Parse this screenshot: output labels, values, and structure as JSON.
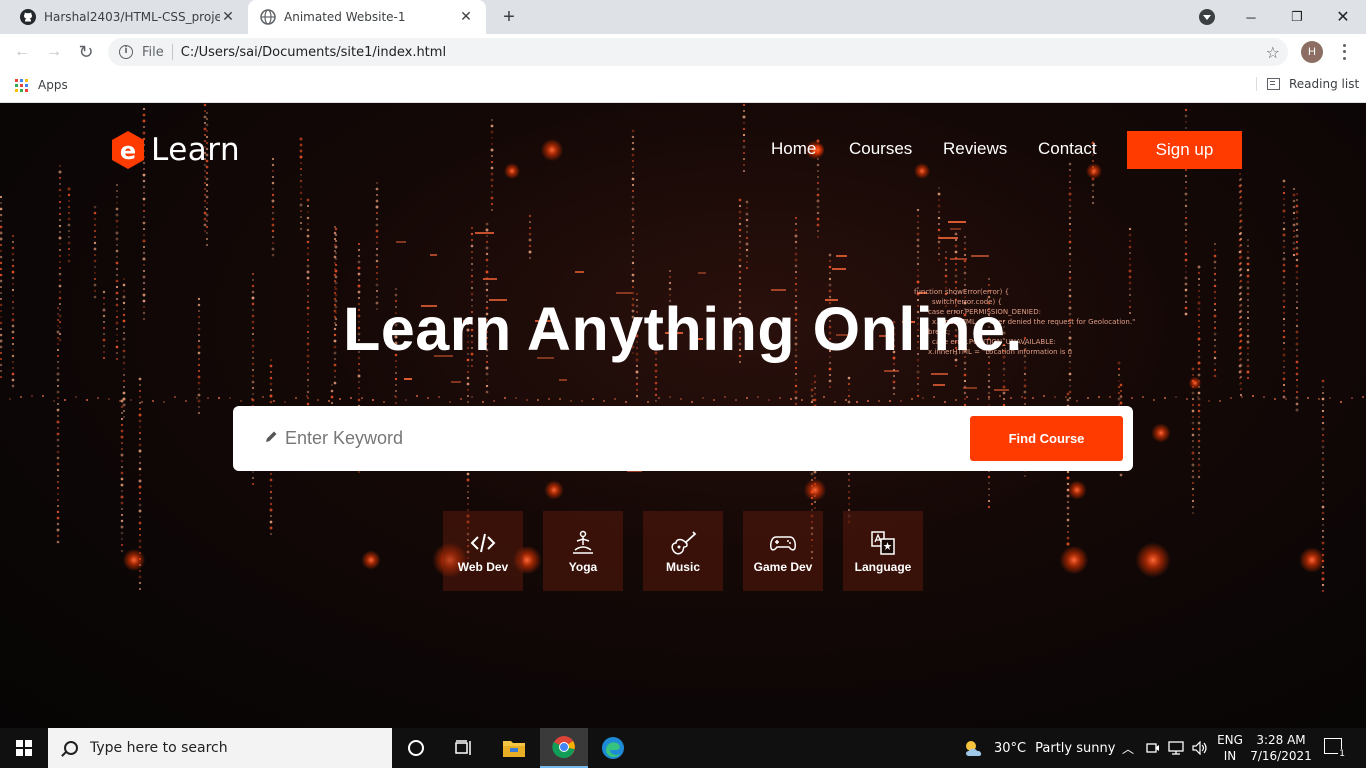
{
  "browser": {
    "tabs": [
      {
        "title": "Harshal2403/HTML-CSS_projects",
        "icon": "github-icon",
        "active": false
      },
      {
        "title": "Animated Website-1",
        "icon": "globe-icon",
        "active": true
      }
    ],
    "omnibox": {
      "scheme_label": "File",
      "url": "C:/Users/sai/Documents/site1/index.html"
    },
    "profile_initial": "H",
    "bookmarks": {
      "apps_label": "Apps",
      "reading_list_label": "Reading list"
    }
  },
  "site": {
    "logo_text": "Learn",
    "logo_letter": "e",
    "nav": [
      "Home",
      "Courses",
      "Reviews",
      "Contact"
    ],
    "signup_label": "Sign up",
    "hero_title": "Learn Anything Online.",
    "search": {
      "placeholder": "Enter Keyword",
      "button_label": "Find Course"
    },
    "categories": [
      {
        "label": "Web Dev",
        "icon": "code-icon"
      },
      {
        "label": "Yoga",
        "icon": "yoga-icon"
      },
      {
        "label": "Music",
        "icon": "guitar-icon"
      },
      {
        "label": "Game Dev",
        "icon": "gamepad-icon"
      },
      {
        "label": "Language",
        "icon": "translate-icon"
      }
    ],
    "bg_code_lines": [
      "function showError(error) {",
      "switch(error.code) {",
      "case error.PERMISSION_DENIED:",
      "x.innerHTML = \"User denied the request for Geolocation.\"",
      "break;",
      "case error.POSITION_UNAVAILABLE:",
      "x.innerHTML = \"Location information is u"
    ],
    "accent_color": "#ff3b00"
  },
  "taskbar": {
    "search_placeholder": "Type here to search",
    "weather": {
      "temp": "30°C",
      "condition": "Partly sunny"
    },
    "language": [
      "ENG",
      "IN"
    ],
    "time": "3:28 AM",
    "date": "7/16/2021",
    "notification_count": "1"
  }
}
